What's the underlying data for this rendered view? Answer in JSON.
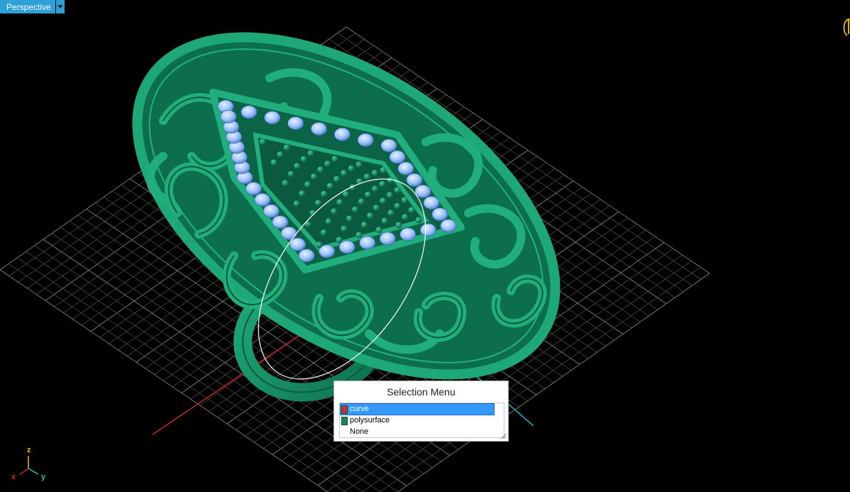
{
  "viewport": {
    "title": "Perspective",
    "background": "#000000"
  },
  "selection_menu": {
    "title": "Selection Menu",
    "items": [
      {
        "label": "curve",
        "color": "#c0392b",
        "selected": true
      },
      {
        "label": "polysurface",
        "color": "#128a62",
        "selected": false
      },
      {
        "label": "None",
        "color": "",
        "selected": false
      }
    ]
  },
  "axes": {
    "z_label": "z",
    "x_label": "x",
    "y_label": "y",
    "x_color": "#d02020",
    "y_color": "#20c0c0",
    "z_color": "#e0c000"
  },
  "model": {
    "ring_color": "#128a62",
    "gem_color": "#9fc4ff",
    "grid_color": "#6a6a6a"
  }
}
